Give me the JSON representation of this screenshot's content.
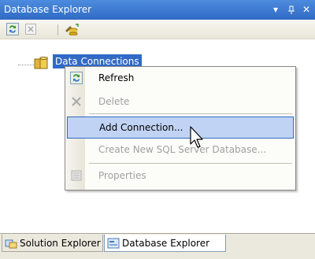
{
  "window": {
    "title": "Database Explorer",
    "controls": [
      "▾",
      "ᵩ",
      "✕"
    ]
  },
  "toolbar": {
    "buttons": [
      {
        "icon": "refresh-icon"
      },
      {
        "icon": "delete-icon"
      },
      {
        "icon": "connect-to-database-icon"
      }
    ]
  },
  "tree": {
    "root_label": "Data Connections",
    "root_icon": "data-connections-icon"
  },
  "context_menu": {
    "items": [
      {
        "label": "Refresh",
        "icon": "refresh-icon",
        "enabled": true
      },
      {
        "label": "Delete",
        "icon": "delete-icon",
        "enabled": false
      },
      {
        "label": "Add Connection...",
        "icon": "",
        "enabled": true,
        "highlighted": true
      },
      {
        "label": "Create New SQL Server Database...",
        "icon": "",
        "enabled": false
      },
      {
        "label": "Properties",
        "icon": "properties-icon",
        "enabled": false
      }
    ]
  },
  "tabs": [
    {
      "label": "Solution Explorer",
      "icon": "solution-explorer-icon",
      "active": false
    },
    {
      "label": "Database Explorer",
      "icon": "database-explorer-icon",
      "active": true
    }
  ],
  "colors": {
    "titlebar": "#3b78d0",
    "selection": "#316ac5",
    "menu_highlight": "#c1d3f4"
  }
}
